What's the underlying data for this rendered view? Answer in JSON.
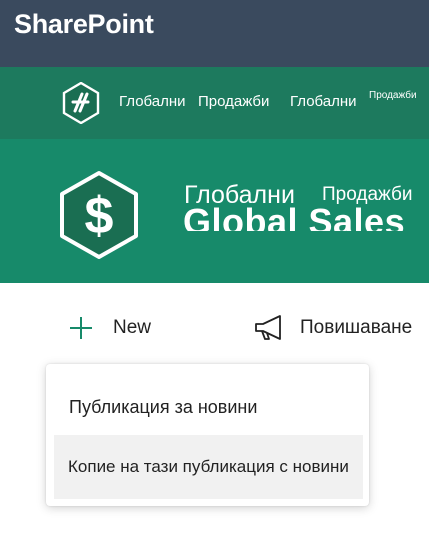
{
  "suite": {
    "title": "SharePoint"
  },
  "hub": {
    "logo_icon": "hub-site-logo-icon",
    "links": [
      "Глобални",
      "Продажби",
      "Глобални",
      "Продажби"
    ]
  },
  "site": {
    "logo_icon": "dollar-hexagon-icon",
    "title_word1": "Глобални",
    "title_word2": "Продажби",
    "title_underlay": "Global Sales"
  },
  "command_bar": {
    "new_label": "New",
    "promote_label": "Повишаване"
  },
  "new_menu": {
    "items": [
      "Публикация за новини",
      "Копие на тази публикация с новини"
    ]
  },
  "colors": {
    "suite_bar": "#3a4a5e",
    "hub_bar": "#1d7a5e",
    "site_header": "#178a6a",
    "accent": "#178a6a"
  }
}
